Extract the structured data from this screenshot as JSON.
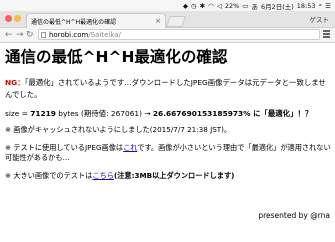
{
  "menubar": {
    "battery": "22%",
    "date": "6月2日(土)",
    "time": "18:53"
  },
  "browser": {
    "tab_title": "通信の最低^H^H最適化の確認",
    "guest": "ゲスト",
    "url_host": "horobi.com",
    "url_path": "/Saiteika/"
  },
  "page": {
    "title": "通信の最低^H^H最適化の確認",
    "ng_label": "NG：",
    "ng_text": "「最適化」されているようです…ダウンロードしたJPEG画像データは元データと一致しませんでした。",
    "size_prefix": "size = ",
    "size_value": "71219",
    "size_mid": " bytes (期待値: 267061) → ",
    "size_pct": "26.667690153185973%",
    "size_suffix": " に「最適化」！？",
    "cache_note": "※ 画像がキャッシュされないようにしました(2015/7/7 21:38 JST)。",
    "test_note_a": "※ テストに使用しているJPEG画像は",
    "test_note_link": "これ",
    "test_note_b": "です。画像が小さいという理由で「最適化」が適用されない可能性があるかも…",
    "big_note_a": "※ 大きい画像でのテストは",
    "big_note_link": "こちら",
    "big_note_b": "(注意:3MB以上ダウンロードします)",
    "footer": "presented by @rna"
  }
}
